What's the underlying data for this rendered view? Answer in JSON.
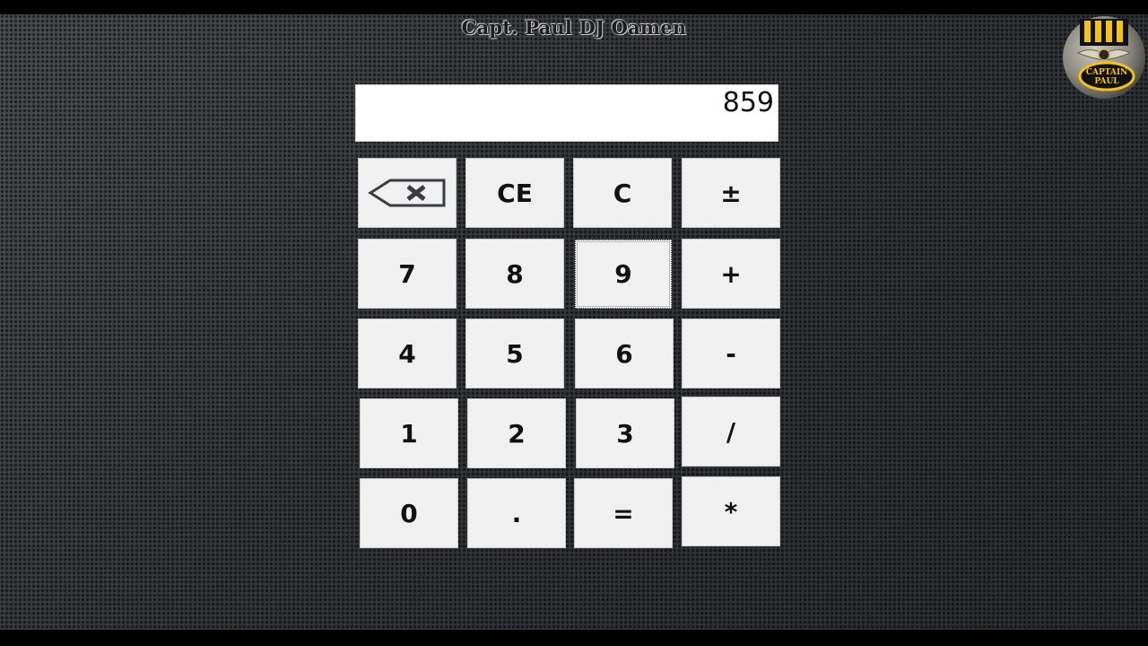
{
  "watermark": {
    "text": "Capt. Paul DJ Oamen"
  },
  "logo": {
    "text_line1": "CAPTAIN",
    "text_line2": "PAUL"
  },
  "display": {
    "value": "859"
  },
  "keys": {
    "backspace": {
      "icon": "backspace-icon"
    },
    "ce": "CE",
    "c": "C",
    "plusminus": "±",
    "seven": "7",
    "eight": "8",
    "nine": "9",
    "plus": "+",
    "four": "4",
    "five": "5",
    "six": "6",
    "minus": "-",
    "one": "1",
    "two": "2",
    "three": "3",
    "divide": "/",
    "zero": "0",
    "dot": ".",
    "equals": "=",
    "multiply": "*"
  },
  "colors": {
    "background": "#3a3d40",
    "key_face": "#f0f0f0",
    "display_bg": "#ffffff",
    "logo_gold": "#f2c21b"
  }
}
